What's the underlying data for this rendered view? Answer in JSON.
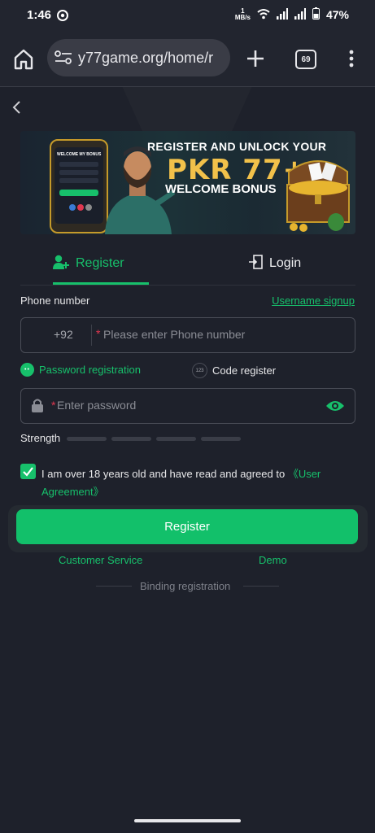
{
  "status_bar": {
    "time": "1:46",
    "net_speed_top": "1",
    "net_speed_unit": "MB/s",
    "battery": "47%"
  },
  "browser": {
    "url": "y77game.org/home/r",
    "tab_count": "69"
  },
  "banner": {
    "phone_title": "WELCOME MY BONUS",
    "headline": "REGISTER AND UNLOCK YOUR",
    "amount": "PKR 77+",
    "bonus": "WELCOME BONUS"
  },
  "tabs": {
    "register": "Register",
    "login": "Login"
  },
  "form": {
    "phone_label": "Phone number",
    "username_link": "Username signup",
    "country_code": "+92",
    "required_mark": "*",
    "phone_placeholder": "Please enter Phone number",
    "password_option": "Password registration",
    "password_badge": "••",
    "code_option": "Code register",
    "code_badge": "123",
    "password_placeholder": "Enter password",
    "strength_label": "Strength",
    "agree_text": "I am over 18 years old and have read and agreed to ",
    "agree_link": "《User Agreement》",
    "agree_checked": true,
    "register_button": "Register",
    "customer_service": "Customer Service",
    "demo": "Demo",
    "binding": "Binding registration"
  },
  "colors": {
    "accent": "#17c06b",
    "background": "#1e212b",
    "required": "#e0374f"
  }
}
